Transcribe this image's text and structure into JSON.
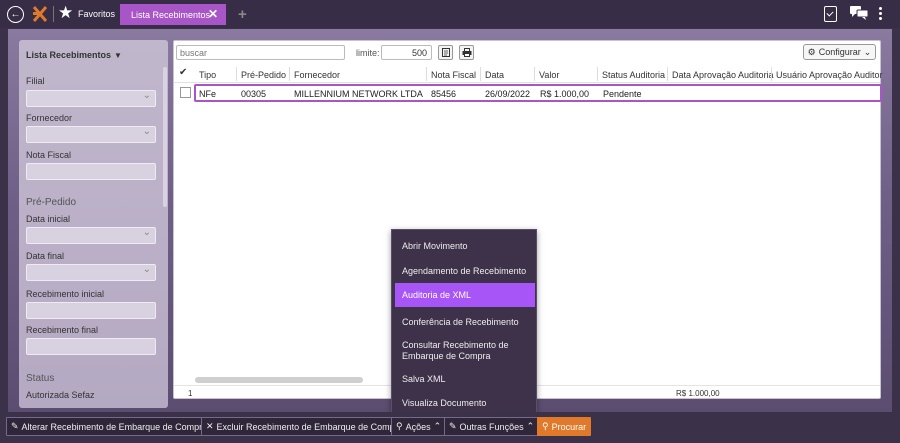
{
  "topbar": {
    "favorites_label": "Favoritos",
    "active_tab": "Lista Recebimentos"
  },
  "sidebar": {
    "title": "Lista Recebimentos",
    "fields": {
      "filial": "Filial",
      "fornecedor": "Fornecedor",
      "nota_fiscal": "Nota Fiscal",
      "data_inicial": "Data inicial",
      "data_final": "Data final",
      "recebimento_inicial": "Recebimento inicial",
      "recebimento_final": "Recebimento final",
      "status_value": "Autorizada Sefaz"
    },
    "sections": {
      "pre_pedido": "Pré-Pedido",
      "status": "Status"
    }
  },
  "toolbar": {
    "search_placeholder": "buscar",
    "limit_label": "limite:",
    "limit_value": "500",
    "configurar": "Configurar"
  },
  "table": {
    "columns": [
      "Tipo",
      "Pré-Pedido",
      "Fornecedor",
      "Nota Fiscal",
      "Data",
      "Valor",
      "Status Auditoria",
      "Data Aprovação Auditoria",
      "Usuário Aprovação Auditor"
    ],
    "rows": [
      {
        "tipo": "NFe",
        "pre_pedido": "00305",
        "fornecedor": "MILLENNIUM NETWORK LTDA",
        "nota_fiscal": "85456",
        "data": "26/09/2022",
        "valor": "R$ 1.000,00",
        "status": "Pendente"
      }
    ],
    "footer_count": "1",
    "footer_total": "R$ 1.000,00"
  },
  "menu": {
    "items": [
      "Abrir Movimento",
      "Agendamento de Recebimento",
      "Auditoria de XML",
      "Conferência de Recebimento",
      "Consultar Recebimento de Embarque de Compra",
      "Salva XML",
      "Visualiza Documento"
    ]
  },
  "bottombar": {
    "alterar": "Alterar Recebimento de Embarque de Compra",
    "excluir": "Excluir Recebimento de Embarque de Compra",
    "acoes": "Ações",
    "outras": "Outras Funções",
    "procurar": "Procurar"
  },
  "colors": {
    "accent": "#a855c8",
    "menu_active": "#a855f7",
    "procurar": "#e07a2a"
  }
}
